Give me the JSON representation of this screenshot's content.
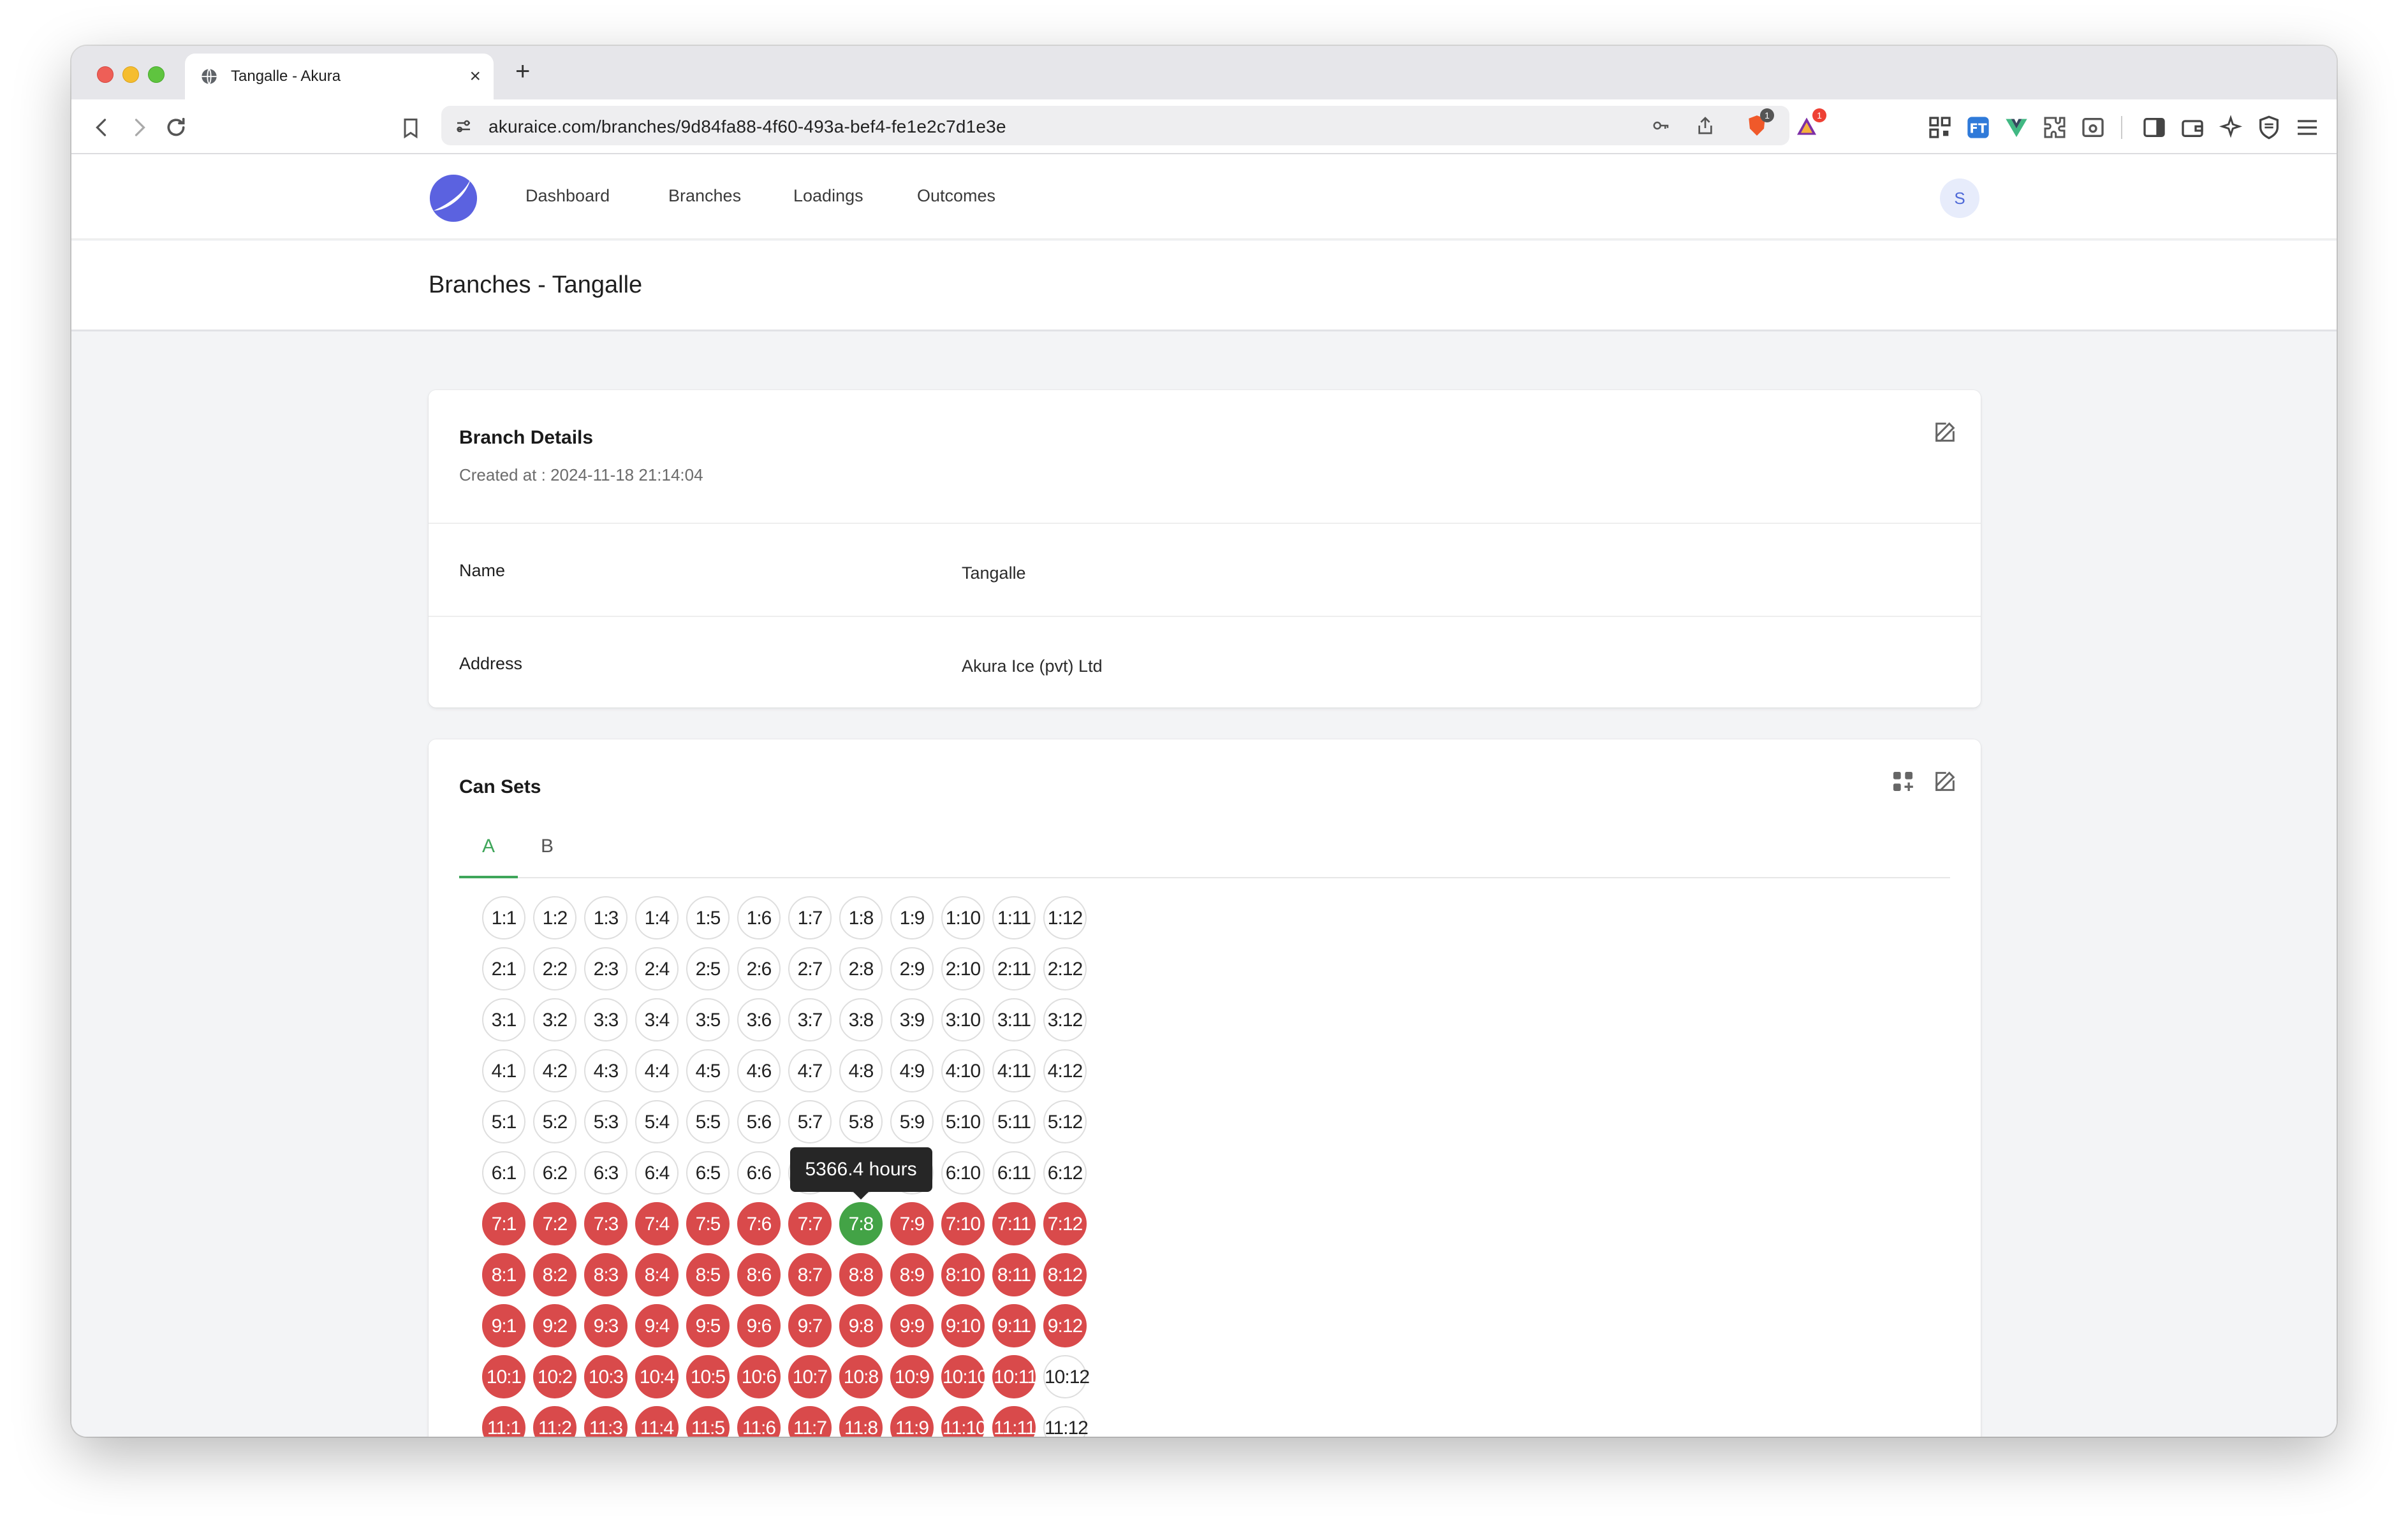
{
  "browser": {
    "tab_title": "Tangalle - Akura",
    "tab_close": "×",
    "new_tab": "+",
    "url": "akuraice.com/branches/9d84fa88-4f60-493a-bef4-fe1e2c7d1e3e",
    "badges": {
      "brave_count": "1",
      "rewards_count": "1"
    }
  },
  "nav": {
    "links": [
      "Dashboard",
      "Branches",
      "Loadings",
      "Outcomes"
    ],
    "avatar_initial": "S"
  },
  "header": {
    "title": "Branches - Tangalle"
  },
  "branch_details": {
    "title": "Branch Details",
    "created_at": "Created at : 2024-11-18 21:14:04",
    "rows": [
      {
        "label": "Name",
        "value": "Tangalle"
      },
      {
        "label": "Address",
        "value": "Akura Ice (pvt) Ltd"
      }
    ]
  },
  "can_sets": {
    "title": "Can Sets",
    "tabs": [
      "A",
      "B"
    ],
    "active_tab": "A",
    "tooltip": "5366.4 hours",
    "tooltip_row": 7,
    "tooltip_col": 8,
    "rows": 11,
    "cols": 12,
    "status_rows": [
      "oooooooooooo",
      "oooooooooooo",
      "oooooooooooo",
      "oooooooooooo",
      "oooooooooooo",
      "oooooooooooo",
      "xxxxxxxgxxxx",
      "xxxxxxxxxxxx",
      "xxxxxxxxxxxx",
      "xxxxxxxxxxxo",
      "xxxxxxxxxxxo"
    ],
    "status_legend": {
      "o": "empty",
      "x": "filled",
      "g": "ready"
    },
    "colors": {
      "filled": "#d94a4b",
      "ready": "#43a346",
      "accent": "#3fa65a"
    }
  }
}
